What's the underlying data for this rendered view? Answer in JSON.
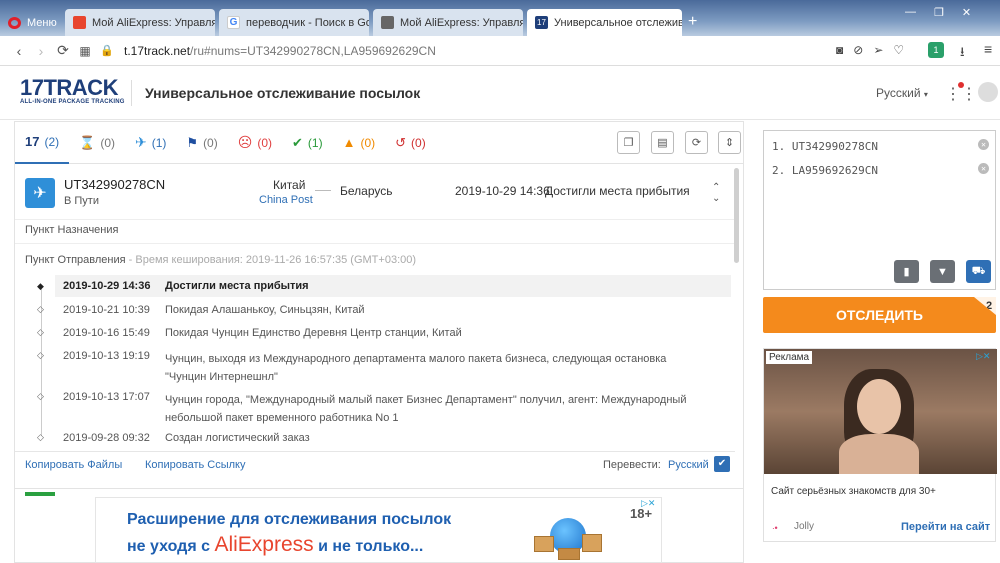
{
  "browser": {
    "menu_label": "Меню",
    "tabs": [
      {
        "label": "Мой AliExpress: Управлять"
      },
      {
        "label": "переводчик - Поиск в Goo"
      },
      {
        "label": "Мой AliExpress: Управлять"
      },
      {
        "label": "Универсальное отслеживание"
      }
    ],
    "new_tab_symbol": "+",
    "url_host": "t.17track.net",
    "url_path": "/ru#nums=UT342990278CN,LA959692629CN",
    "ext_badge": "1"
  },
  "site": {
    "logo_text": "17TRACK",
    "logo_sub": "ALL-IN-ONE PACKAGE TRACKING",
    "title": "Универсальное отслеживание посылок",
    "language": "Русский"
  },
  "filters": [
    {
      "icon": "17-icon",
      "count": "(2)",
      "color": "#2f6fb5"
    },
    {
      "icon": "hourglass-icon",
      "count": "(0)",
      "color": "#888"
    },
    {
      "icon": "airplane-icon",
      "count": "(1)",
      "color": "#2f8fd8"
    },
    {
      "icon": "flag-icon",
      "count": "(0)",
      "color": "#1f4fa0"
    },
    {
      "icon": "sad-face-icon",
      "count": "(0)",
      "color": "#e04040"
    },
    {
      "icon": "check-icon",
      "count": "(1)",
      "color": "#2a9a3a"
    },
    {
      "icon": "warning-icon",
      "count": "(0)",
      "color": "#f08a00"
    },
    {
      "icon": "history-icon",
      "count": "(0)",
      "color": "#d03030"
    }
  ],
  "parcel": {
    "number": "UT342990278CN",
    "status": "В Пути",
    "origin_country": "Китай",
    "carrier": "China Post",
    "dest_country": "Беларусь",
    "latest_time": "2019-10-29 14:36",
    "latest_event": "Достигли места прибытия",
    "dest_point_label": "Пункт Назначения",
    "origin_point_label": "Пункт Отправления",
    "cache_note": "- Время кеширования: 2019-11-26 16:57:35 (GMT+03:00)",
    "events": [
      {
        "time": "2019-10-29 14:36",
        "text": "Достигли места прибытия"
      },
      {
        "time": "2019-10-21 10:39",
        "text": "Покидая Алашанькоу, Синьцзян, Китай"
      },
      {
        "time": "2019-10-16 15:49",
        "text": "Покидая Чунцин Единство Деревня Центр станции, Китай"
      },
      {
        "time": "2019-10-13 19:19",
        "text": "Чунцин, выходя из Международного департамента малого пакета бизнеса, следующая остановка \"Чунцин Интернешнл\""
      },
      {
        "time": "2019-10-13 17:07",
        "text": "Чунцин города, \"Международный малый пакет Бизнес Департамент\" получил, агент: Международный небольшой пакет временного работника No 1"
      },
      {
        "time": "2019-09-28 09:32",
        "text": "Создан логистический заказ"
      }
    ],
    "copy_files": "Копировать Файлы",
    "copy_link": "Копировать Ссылку",
    "translate_label": "Перевести:",
    "translate_lang": "Русский"
  },
  "banner": {
    "line1": "Расширение для отслеживания посылок",
    "line2_pre": "не уходя с",
    "line2_brand": "AliExpress",
    "line2_post": "и не только...",
    "age": "18+"
  },
  "tracker": {
    "numbers": [
      "1. UT342990278CN",
      "2. LA959692629CN"
    ],
    "track_button": "ОТСЛЕДИТЬ",
    "track_badge": "2"
  },
  "ad": {
    "label": "Реклама",
    "caption": "Сайт серьёзных знакомств для 30+",
    "brand": "Jolly",
    "link": "Перейти на сайт"
  }
}
